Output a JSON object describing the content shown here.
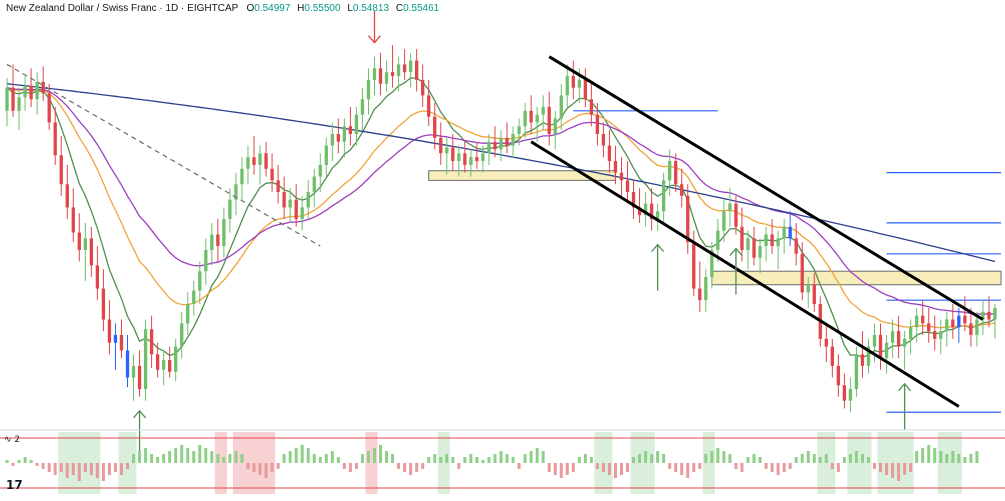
{
  "header": {
    "symbol": "New Zealand Dollar / Swiss Franc · 1D · EIGHTCAP",
    "o_label": "O",
    "o_value": "0.54997",
    "h_label": "H",
    "h_value": "0.55500",
    "l_label": "L",
    "l_value": "0.54813",
    "c_label": "C",
    "c_value": "0.55461"
  },
  "indicator": {
    "label": "∿ 2"
  },
  "branding": {
    "logo": "17"
  },
  "colors": {
    "up": "#6fbf6a",
    "down": "#e0454a",
    "blue_candle": "#2962ff",
    "ema_fast": "#4f8f4f",
    "ema_mid": "#f0a43a",
    "ema_slow": "#9c3fc0",
    "ema_long": "#2b3f8f",
    "channel": "#000000",
    "zone_fill": "#f8eebb",
    "zone_border": "#6b6b6b",
    "hline": "#2962ff",
    "arrow_up": "#4f8f4f",
    "arrow_down": "#e0454a",
    "osc_up": "#8fcf8a",
    "osc_down": "#e89a9c",
    "osc_bg_green": "#d9eedb",
    "osc_bg_red": "#f8d2d3",
    "osc_band": "#e0454a"
  },
  "chart_data": {
    "type": "candlestick",
    "title": "New Zealand Dollar / Swiss Franc · 1D · EIGHTCAP",
    "n_bars": 165,
    "ylim": [
      0.5358,
      0.5565
    ],
    "bars": [
      [
        0.5518,
        0.5535,
        0.551,
        0.553
      ],
      [
        0.553,
        0.5542,
        0.5515,
        0.5518
      ],
      [
        0.5518,
        0.553,
        0.5508,
        0.5525
      ],
      [
        0.5525,
        0.5536,
        0.5518,
        0.5531
      ],
      [
        0.5531,
        0.554,
        0.552,
        0.5524
      ],
      [
        0.5524,
        0.5538,
        0.5516,
        0.5533
      ],
      [
        0.5533,
        0.5541,
        0.5523,
        0.5527
      ],
      [
        0.5527,
        0.5532,
        0.5508,
        0.5512
      ],
      [
        0.5512,
        0.552,
        0.549,
        0.5495
      ],
      [
        0.5495,
        0.5505,
        0.5474,
        0.548
      ],
      [
        0.548,
        0.549,
        0.5462,
        0.5468
      ],
      [
        0.5468,
        0.5478,
        0.545,
        0.5455
      ],
      [
        0.5455,
        0.5465,
        0.544,
        0.5446
      ],
      [
        0.5446,
        0.546,
        0.543,
        0.5452
      ],
      [
        0.5452,
        0.5458,
        0.5432,
        0.5438
      ],
      [
        0.5438,
        0.5448,
        0.542,
        0.5426
      ],
      [
        0.5426,
        0.5436,
        0.5404,
        0.541
      ],
      [
        0.541,
        0.542,
        0.5392,
        0.5398
      ],
      [
        0.5398,
        0.5408,
        0.5384,
        0.5402
      ],
      [
        0.5402,
        0.541,
        0.539,
        0.5394
      ],
      [
        0.5394,
        0.5402,
        0.5375,
        0.538
      ],
      [
        0.538,
        0.5392,
        0.5368,
        0.5386
      ],
      [
        0.5386,
        0.5394,
        0.537,
        0.5374
      ],
      [
        0.5374,
        0.541,
        0.5368,
        0.5405
      ],
      [
        0.5405,
        0.5412,
        0.5385,
        0.5392
      ],
      [
        0.5392,
        0.5398,
        0.538,
        0.5384
      ],
      [
        0.5384,
        0.5394,
        0.5376,
        0.5389
      ],
      [
        0.5389,
        0.5396,
        0.538,
        0.5383
      ],
      [
        0.5383,
        0.54,
        0.5378,
        0.5396
      ],
      [
        0.5396,
        0.5414,
        0.539,
        0.5408
      ],
      [
        0.5408,
        0.5424,
        0.5402,
        0.5418
      ],
      [
        0.5418,
        0.543,
        0.5412,
        0.5425
      ],
      [
        0.5425,
        0.544,
        0.5418,
        0.5435
      ],
      [
        0.5435,
        0.5452,
        0.5428,
        0.5446
      ],
      [
        0.5446,
        0.546,
        0.5438,
        0.5454
      ],
      [
        0.5454,
        0.5462,
        0.544,
        0.5448
      ],
      [
        0.5448,
        0.5468,
        0.5442,
        0.5462
      ],
      [
        0.5462,
        0.5478,
        0.5455,
        0.5472
      ],
      [
        0.5472,
        0.5486,
        0.5464,
        0.548
      ],
      [
        0.548,
        0.5494,
        0.5472,
        0.5488
      ],
      [
        0.5488,
        0.55,
        0.548,
        0.5494
      ],
      [
        0.5494,
        0.5505,
        0.5485,
        0.549
      ],
      [
        0.549,
        0.55,
        0.548,
        0.5496
      ],
      [
        0.5496,
        0.5502,
        0.5484,
        0.5488
      ],
      [
        0.5488,
        0.5496,
        0.5476,
        0.5482
      ],
      [
        0.5482,
        0.549,
        0.547,
        0.5476
      ],
      [
        0.5476,
        0.5484,
        0.5462,
        0.5468
      ],
      [
        0.5468,
        0.5478,
        0.546,
        0.5472
      ],
      [
        0.5472,
        0.548,
        0.5458,
        0.5462
      ],
      [
        0.5462,
        0.5474,
        0.5456,
        0.5468
      ],
      [
        0.5468,
        0.5482,
        0.5462,
        0.5476
      ],
      [
        0.5476,
        0.5488,
        0.5468,
        0.5484
      ],
      [
        0.5484,
        0.5496,
        0.5476,
        0.549
      ],
      [
        0.549,
        0.5504,
        0.5484,
        0.55
      ],
      [
        0.55,
        0.5512,
        0.5492,
        0.5506
      ],
      [
        0.5506,
        0.5514,
        0.5496,
        0.5502
      ],
      [
        0.5502,
        0.5514,
        0.5494,
        0.551
      ],
      [
        0.551,
        0.552,
        0.55,
        0.5506
      ],
      [
        0.5506,
        0.552,
        0.55,
        0.5516
      ],
      [
        0.5516,
        0.553,
        0.5508,
        0.5524
      ],
      [
        0.5524,
        0.554,
        0.5516,
        0.5534
      ],
      [
        0.5534,
        0.5546,
        0.5526,
        0.554
      ],
      [
        0.554,
        0.5548,
        0.5526,
        0.5532
      ],
      [
        0.5532,
        0.5544,
        0.5528,
        0.5538
      ],
      [
        0.5538,
        0.5552,
        0.553,
        0.5536
      ],
      [
        0.5536,
        0.5546,
        0.5528,
        0.5542
      ],
      [
        0.5542,
        0.555,
        0.5534,
        0.5538
      ],
      [
        0.5538,
        0.5548,
        0.553,
        0.5544
      ],
      [
        0.5544,
        0.555,
        0.5528,
        0.5534
      ],
      [
        0.5534,
        0.5542,
        0.552,
        0.5526
      ],
      [
        0.5526,
        0.5534,
        0.551,
        0.5515
      ],
      [
        0.5515,
        0.5522,
        0.5498,
        0.5504
      ],
      [
        0.5504,
        0.5512,
        0.549,
        0.5496
      ],
      [
        0.5496,
        0.5504,
        0.5485,
        0.5499
      ],
      [
        0.5499,
        0.5506,
        0.5487,
        0.5492
      ],
      [
        0.5492,
        0.55,
        0.5484,
        0.5496
      ],
      [
        0.5496,
        0.5502,
        0.5486,
        0.549
      ],
      [
        0.549,
        0.5498,
        0.5484,
        0.5494
      ],
      [
        0.5494,
        0.5502,
        0.5488,
        0.5492
      ],
      [
        0.5492,
        0.55,
        0.5486,
        0.5496
      ],
      [
        0.5496,
        0.5506,
        0.549,
        0.5502
      ],
      [
        0.5502,
        0.551,
        0.5494,
        0.5498
      ],
      [
        0.5498,
        0.5508,
        0.5492,
        0.5504
      ],
      [
        0.5504,
        0.5512,
        0.5496,
        0.55
      ],
      [
        0.55,
        0.551,
        0.5494,
        0.5506
      ],
      [
        0.5506,
        0.5514,
        0.55,
        0.551
      ],
      [
        0.551,
        0.5522,
        0.5504,
        0.5518
      ],
      [
        0.5518,
        0.5526,
        0.5506,
        0.5512
      ],
      [
        0.5512,
        0.552,
        0.5502,
        0.5516
      ],
      [
        0.5516,
        0.5526,
        0.5508,
        0.552
      ],
      [
        0.552,
        0.5528,
        0.55,
        0.5506
      ],
      [
        0.5506,
        0.5518,
        0.5498,
        0.5514
      ],
      [
        0.5514,
        0.5532,
        0.5508,
        0.5526
      ],
      [
        0.5526,
        0.5542,
        0.552,
        0.5536
      ],
      [
        0.5536,
        0.5544,
        0.5524,
        0.553
      ],
      [
        0.553,
        0.554,
        0.5522,
        0.5534
      ],
      [
        0.5534,
        0.554,
        0.552,
        0.5524
      ],
      [
        0.5524,
        0.5532,
        0.551,
        0.5516
      ],
      [
        0.5516,
        0.5522,
        0.55,
        0.5506
      ],
      [
        0.5506,
        0.5512,
        0.5494,
        0.55
      ],
      [
        0.55,
        0.5508,
        0.5486,
        0.5492
      ],
      [
        0.5492,
        0.55,
        0.548,
        0.5486
      ],
      [
        0.5486,
        0.5494,
        0.5474,
        0.5482
      ],
      [
        0.5482,
        0.5492,
        0.547,
        0.5476
      ],
      [
        0.5476,
        0.5482,
        0.5462,
        0.5468
      ],
      [
        0.5468,
        0.5478,
        0.546,
        0.5464
      ],
      [
        0.5464,
        0.5476,
        0.5458,
        0.547
      ],
      [
        0.547,
        0.5478,
        0.5456,
        0.5462
      ],
      [
        0.5462,
        0.547,
        0.5456,
        0.5466
      ],
      [
        0.5466,
        0.5486,
        0.546,
        0.5482
      ],
      [
        0.5482,
        0.5498,
        0.5474,
        0.5492
      ],
      [
        0.5492,
        0.5496,
        0.5476,
        0.548
      ],
      [
        0.548,
        0.5488,
        0.5468,
        0.5474
      ],
      [
        0.5474,
        0.548,
        0.5444,
        0.545
      ],
      [
        0.545,
        0.5456,
        0.5422,
        0.5426
      ],
      [
        0.5426,
        0.544,
        0.5414,
        0.542
      ],
      [
        0.542,
        0.5436,
        0.5414,
        0.5432
      ],
      [
        0.5432,
        0.545,
        0.5426,
        0.5446
      ],
      [
        0.5446,
        0.5462,
        0.544,
        0.5456
      ],
      [
        0.5456,
        0.5472,
        0.545,
        0.5466
      ],
      [
        0.5466,
        0.5478,
        0.5458,
        0.547
      ],
      [
        0.547,
        0.5474,
        0.5454,
        0.5458
      ],
      [
        0.5458,
        0.5468,
        0.544,
        0.5446
      ],
      [
        0.5446,
        0.5456,
        0.5436,
        0.5452
      ],
      [
        0.5452,
        0.5458,
        0.5438,
        0.5442
      ],
      [
        0.5442,
        0.5452,
        0.5434,
        0.5448
      ],
      [
        0.5448,
        0.5458,
        0.544,
        0.5454
      ],
      [
        0.5454,
        0.5462,
        0.5444,
        0.5448
      ],
      [
        0.5448,
        0.5456,
        0.5436,
        0.5452
      ],
      [
        0.5452,
        0.5462,
        0.5444,
        0.5458
      ],
      [
        0.5458,
        0.5466,
        0.5448,
        0.5452
      ],
      [
        0.5452,
        0.546,
        0.5438,
        0.5444
      ],
      [
        0.5444,
        0.545,
        0.542,
        0.5424
      ],
      [
        0.5424,
        0.5432,
        0.5416,
        0.5428
      ],
      [
        0.5428,
        0.5434,
        0.5414,
        0.5418
      ],
      [
        0.5418,
        0.5422,
        0.5396,
        0.54
      ],
      [
        0.54,
        0.5408,
        0.5388,
        0.5396
      ],
      [
        0.5396,
        0.54,
        0.538,
        0.5386
      ],
      [
        0.5386,
        0.5392,
        0.537,
        0.5376
      ],
      [
        0.5376,
        0.5382,
        0.5364,
        0.5368
      ],
      [
        0.5368,
        0.538,
        0.5362,
        0.5374
      ],
      [
        0.5374,
        0.5396,
        0.537,
        0.5392
      ],
      [
        0.5392,
        0.5404,
        0.538,
        0.5386
      ],
      [
        0.5386,
        0.54,
        0.5382,
        0.5396
      ],
      [
        0.5396,
        0.5408,
        0.5388,
        0.5402
      ],
      [
        0.5402,
        0.5408,
        0.5384,
        0.539
      ],
      [
        0.539,
        0.5402,
        0.5382,
        0.5398
      ],
      [
        0.5398,
        0.541,
        0.539,
        0.5404
      ],
      [
        0.5404,
        0.5412,
        0.539,
        0.5396
      ],
      [
        0.5396,
        0.5404,
        0.5384,
        0.54
      ],
      [
        0.54,
        0.541,
        0.5392,
        0.5406
      ],
      [
        0.5406,
        0.5416,
        0.5398,
        0.5412
      ],
      [
        0.5412,
        0.542,
        0.5402,
        0.5408
      ],
      [
        0.5408,
        0.5416,
        0.5398,
        0.5404
      ],
      [
        0.5404,
        0.5412,
        0.5394,
        0.54
      ],
      [
        0.54,
        0.541,
        0.5392,
        0.5404
      ],
      [
        0.5404,
        0.5414,
        0.5396,
        0.541
      ],
      [
        0.541,
        0.5418,
        0.54,
        0.5406
      ],
      [
        0.5406,
        0.5416,
        0.5398,
        0.5412
      ],
      [
        0.5412,
        0.5422,
        0.5404,
        0.5408
      ],
      [
        0.5408,
        0.5416,
        0.5396,
        0.5402
      ],
      [
        0.5402,
        0.5414,
        0.5396,
        0.541
      ],
      [
        0.541,
        0.542,
        0.5402,
        0.5414
      ],
      [
        0.5414,
        0.5422,
        0.5406,
        0.541
      ],
      [
        0.541,
        0.5418,
        0.54,
        0.5416
      ]
    ],
    "blue_candle_indices": [
      18,
      20,
      130,
      158
    ],
    "ma_series": [
      {
        "key": "ema_fast",
        "period": 8
      },
      {
        "key": "ema_mid",
        "period": 21
      },
      {
        "key": "ema_slow",
        "period": 34
      },
      {
        "key": "ema_long",
        "period": 200,
        "start": 0.5532,
        "end": 0.544
      }
    ],
    "trendlines": [
      {
        "style": "dashed",
        "color_key": "zone_border",
        "from": [
          0,
          0.5542
        ],
        "to": [
          52,
          0.5448
        ]
      },
      {
        "style": "solid",
        "color_key": "channel",
        "from": [
          90,
          0.5546
        ],
        "to": [
          162,
          0.541
        ]
      },
      {
        "style": "solid",
        "color_key": "channel",
        "from": [
          87,
          0.5502
        ],
        "to": [
          158,
          0.5365
        ]
      }
    ],
    "zones": [
      {
        "x0": 70,
        "x1": 101,
        "y0": 0.5482,
        "y1": 0.5487
      },
      {
        "x0": 117,
        "x1": 165,
        "y0": 0.5428,
        "y1": 0.5435
      }
    ],
    "hlines": [
      {
        "x0": 94,
        "x1": 118,
        "y": 0.5518
      },
      {
        "x0": 146,
        "x1": 165,
        "y": 0.5486
      },
      {
        "x0": 146,
        "x1": 165,
        "y": 0.546
      },
      {
        "x0": 146,
        "x1": 165,
        "y": 0.5444
      },
      {
        "x0": 146,
        "x1": 165,
        "y": 0.542
      },
      {
        "x0": 146,
        "x1": 165,
        "y": 0.5362
      }
    ],
    "arrows_up": [
      22,
      108,
      121,
      149
    ],
    "arrows_down": [
      61
    ],
    "oscillator": {
      "values": [
        1,
        -1,
        1,
        2,
        1,
        -1,
        -2,
        -3,
        -4,
        -3,
        -5,
        -4,
        -6,
        -3,
        -4,
        -5,
        -6,
        -4,
        -3,
        -4,
        -2,
        3,
        4,
        5,
        3,
        2,
        3,
        4,
        5,
        6,
        5,
        4,
        6,
        5,
        4,
        3,
        2,
        3,
        4,
        3,
        -2,
        -3,
        -4,
        -5,
        -3,
        -2,
        3,
        4,
        5,
        6,
        5,
        3,
        2,
        3,
        4,
        2,
        -2,
        -3,
        -2,
        3,
        4,
        5,
        6,
        4,
        3,
        -2,
        -3,
        -4,
        -3,
        -2,
        2,
        3,
        2,
        3,
        2,
        -2,
        2,
        3,
        2,
        1,
        2,
        3,
        4,
        3,
        2,
        -2,
        3,
        4,
        5,
        4,
        -3,
        -4,
        -5,
        -4,
        -3,
        2,
        3,
        2,
        -2,
        -3,
        -4,
        -5,
        -4,
        -3,
        2,
        3,
        4,
        3,
        4,
        3,
        -2,
        -3,
        -4,
        -5,
        -3,
        -2,
        3,
        4,
        5,
        4,
        3,
        -2,
        -3,
        2,
        3,
        2,
        -2,
        -3,
        -4,
        -3,
        -2,
        2,
        3,
        4,
        3,
        2,
        3,
        -2,
        -3,
        2,
        3,
        4,
        3,
        2,
        -2,
        -3,
        -4,
        -5,
        -6,
        -4,
        -3,
        4,
        5,
        6,
        5,
        4,
        3,
        4,
        3,
        2,
        3,
        4
      ],
      "green_shade": [
        [
          9,
          15
        ],
        [
          19,
          21
        ],
        [
          72,
          73
        ],
        [
          98,
          100
        ],
        [
          104,
          107
        ],
        [
          116,
          117
        ],
        [
          135,
          137
        ],
        [
          140,
          143
        ],
        [
          145,
          150
        ],
        [
          155,
          158
        ]
      ],
      "red_shade": [
        [
          35,
          36
        ],
        [
          38,
          44
        ],
        [
          60,
          61
        ]
      ]
    }
  }
}
